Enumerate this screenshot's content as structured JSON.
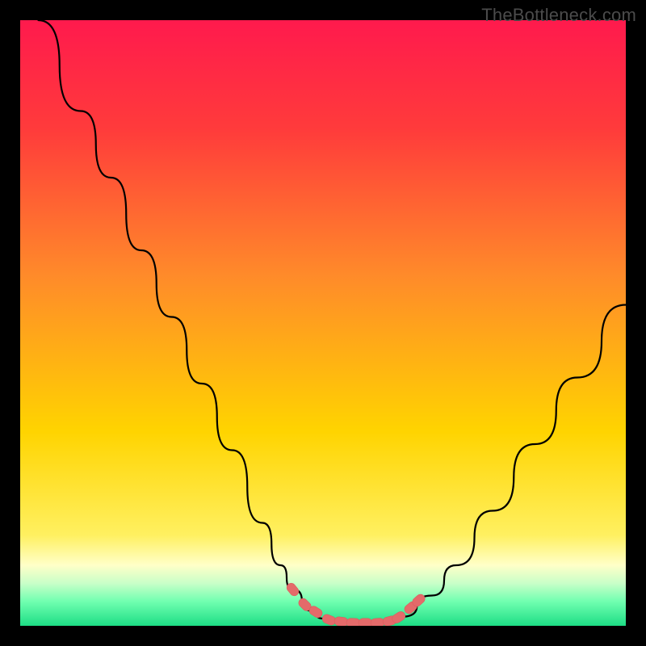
{
  "watermark": "TheBottleneck.com",
  "colors": {
    "frame": "#000000",
    "gradient_top": "#ff1a4d",
    "gradient_mid1": "#ff7a2a",
    "gradient_mid2": "#ffe000",
    "gradient_bottom1": "#ffffa0",
    "gradient_bottom2": "#4dffb0",
    "gradient_bottom3": "#1de085",
    "curve": "#000000",
    "marker": "#e46a6a",
    "marker_edge": "#d85a5a"
  },
  "chart_data": {
    "type": "line",
    "title": "",
    "xlabel": "",
    "ylabel": "",
    "xlim": [
      0,
      100
    ],
    "ylim": [
      0,
      100
    ],
    "series": [
      {
        "name": "bottleneck-curve",
        "x": [
          3,
          10,
          15,
          20,
          25,
          30,
          35,
          40,
          43,
          45,
          48,
          50,
          52,
          55,
          58,
          60,
          63,
          68,
          72,
          78,
          85,
          92,
          100
        ],
        "y": [
          100,
          85,
          74,
          62,
          51,
          40,
          29,
          17,
          10,
          6,
          2.5,
          1.2,
          0.7,
          0.5,
          0.5,
          0.6,
          1.5,
          5,
          10,
          19,
          30,
          41,
          53
        ]
      }
    ],
    "markers": {
      "name": "highlighted-points",
      "x": [
        45.0,
        47.0,
        48.8,
        51.0,
        53.0,
        55.0,
        57.0,
        59.0,
        61.0,
        62.5,
        64.5,
        65.8
      ],
      "y": [
        6.0,
        3.5,
        2.3,
        1.0,
        0.7,
        0.5,
        0.5,
        0.5,
        0.8,
        1.4,
        3.0,
        4.2
      ]
    },
    "background_gradient_stops": [
      {
        "pos": 0.0,
        "color": "#ff1a4d"
      },
      {
        "pos": 0.18,
        "color": "#ff3b3b"
      },
      {
        "pos": 0.42,
        "color": "#ff8a2a"
      },
      {
        "pos": 0.68,
        "color": "#ffd400"
      },
      {
        "pos": 0.85,
        "color": "#fff060"
      },
      {
        "pos": 0.9,
        "color": "#ffffc8"
      },
      {
        "pos": 0.93,
        "color": "#c8ffc8"
      },
      {
        "pos": 0.96,
        "color": "#70ffb0"
      },
      {
        "pos": 1.0,
        "color": "#1ddd85"
      }
    ]
  }
}
